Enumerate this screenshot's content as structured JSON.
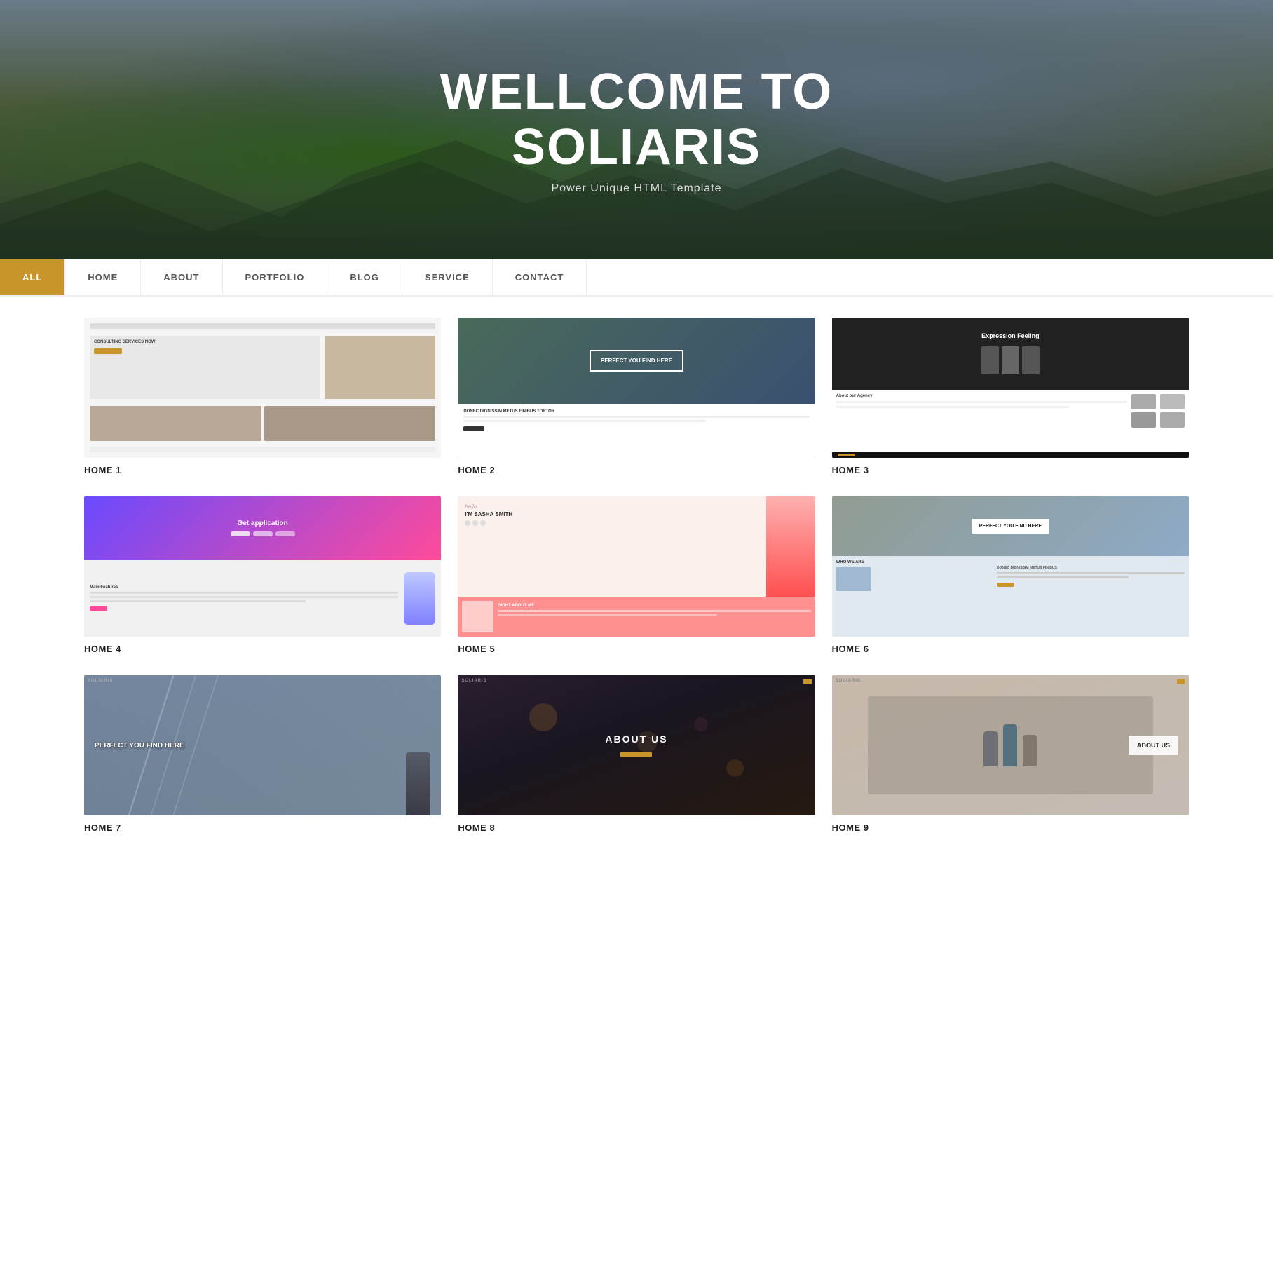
{
  "hero": {
    "title_line1": "WELLCOME TO",
    "title_line2": "SOLIARIS",
    "subtitle": "Power Unique HTML Template"
  },
  "nav": {
    "items": [
      {
        "label": "ALL",
        "active": true
      },
      {
        "label": "HOME",
        "active": false
      },
      {
        "label": "ABOUT",
        "active": false
      },
      {
        "label": "PORTFOLIO",
        "active": false
      },
      {
        "label": "BLOG",
        "active": false
      },
      {
        "label": "SERVICE",
        "active": false
      },
      {
        "label": "CONTACT",
        "active": false
      }
    ]
  },
  "grid": {
    "rows": [
      [
        {
          "id": "home1",
          "label": "HOME 1"
        },
        {
          "id": "home2",
          "label": "HOME 2"
        },
        {
          "id": "home3",
          "label": "HOME 3"
        }
      ],
      [
        {
          "id": "home4",
          "label": "HOME 4"
        },
        {
          "id": "home5",
          "label": "HOME 5"
        },
        {
          "id": "home6",
          "label": "HOME 6"
        }
      ],
      [
        {
          "id": "home7",
          "label": "HOME 7"
        },
        {
          "id": "home8",
          "label": "HOME 8"
        },
        {
          "id": "home9",
          "label": "HOME 9"
        }
      ]
    ]
  },
  "thumbs": {
    "home1": {
      "heading": "CONSULTING SERVICES NOW",
      "btn": ""
    },
    "home2": {
      "heading": "PERFECT YOU FIND HERE",
      "sub": "DONEC DIGNISSIM METUS FINIBUS TORTOR"
    },
    "home3": {
      "heading": "Expression Feeling"
    },
    "home4": {
      "heading": "Get application",
      "feature_title": "Main Features"
    },
    "home5": {
      "cursive": "hello",
      "name": "I'M SASHA SMITH",
      "section": "SIGHT ABOUT ME"
    },
    "home6": {
      "heading": "PERFECT YOU FIND HERE",
      "who": "WHO WE ARE",
      "sub": "DONEC DIGNISSIM METUS FINIBUS"
    },
    "home7": {
      "heading": "PERFECT YOU FIND HERE"
    },
    "home8": {
      "heading": "ABOUT US"
    },
    "home9": {
      "heading": "ABOUT US"
    }
  },
  "colors": {
    "accent": "#c8952a",
    "dark": "#111111",
    "nav_active_bg": "#c8952a"
  }
}
